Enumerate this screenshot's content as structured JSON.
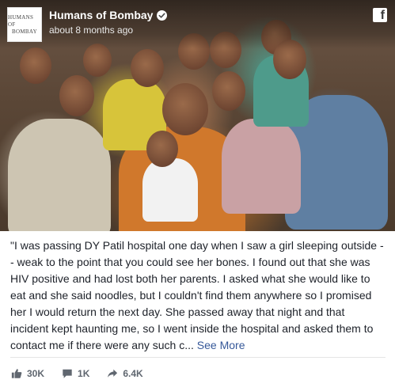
{
  "post": {
    "page_name": "Humans of Bombay",
    "logo_text_line1": "HUMANS OF",
    "logo_text_line2": "BOMBAY",
    "time": "about 8 months ago",
    "caption": "\"I was passing DY Patil hospital one day when I saw a girl sleeping outside -- weak to the point that you could see her bones. I found out that she was HIV positive and had lost both her parents. I asked what she would like to eat and she said noodles, but I couldn't find them anywhere so I promised her I would return the next day. She passed away that night and that incident kept haunting me, so I went inside the hospital and asked them to contact me if there were any such c...",
    "see_more": "See More"
  },
  "stats": {
    "likes": "30K",
    "comments": "1K",
    "shares": "6.4K"
  },
  "icons": {
    "brand": "facebook-icon",
    "verified": "verified-badge-icon",
    "like": "thumbs-up-icon",
    "comment": "comment-icon",
    "share": "share-arrow-icon"
  },
  "colors": {
    "link": "#365899",
    "text": "#1d2129",
    "muted": "#606770"
  }
}
